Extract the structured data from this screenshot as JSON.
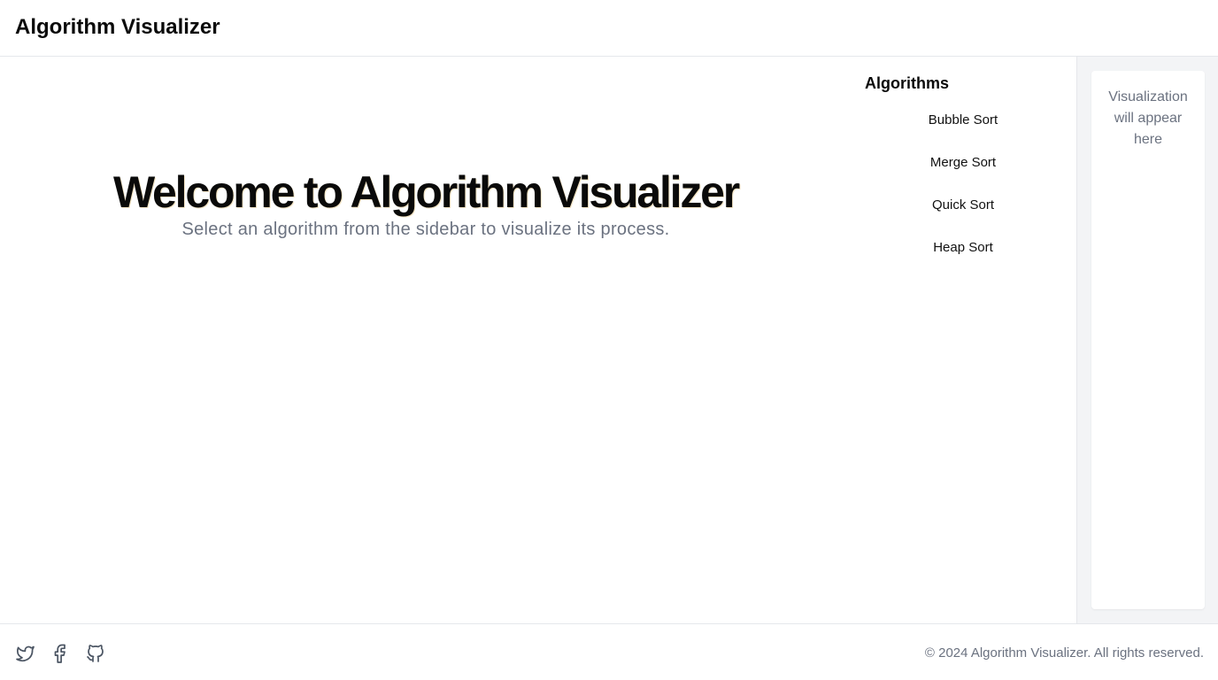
{
  "header": {
    "title": "Algorithm Visualizer"
  },
  "main": {
    "welcome_title": "Welcome to Algorithm Visualizer",
    "welcome_subtitle": "Select an algorithm from the sidebar to visualize its process."
  },
  "sidebar": {
    "heading": "Algorithms",
    "items": [
      {
        "label": "Bubble Sort"
      },
      {
        "label": "Merge Sort"
      },
      {
        "label": "Quick Sort"
      },
      {
        "label": "Heap Sort"
      }
    ]
  },
  "visualization": {
    "placeholder": "Visualization will appear here"
  },
  "footer": {
    "social_icons": [
      "twitter-icon",
      "facebook-icon",
      "github-icon"
    ],
    "copyright": "© 2024 Algorithm Visualizer. All rights reserved."
  },
  "colors": {
    "text_primary": "#0a0a0a",
    "text_muted": "#6b7280",
    "panel_bg": "#f3f4f6",
    "border": "#e5e7eb"
  }
}
